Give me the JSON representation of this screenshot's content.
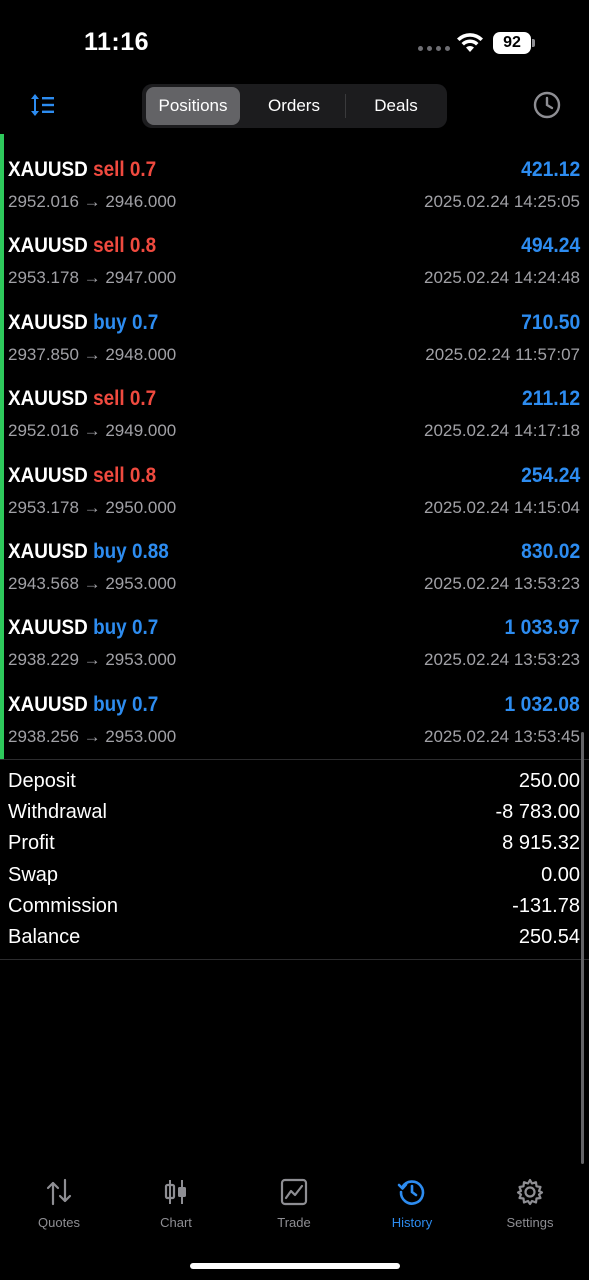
{
  "status_bar": {
    "time": "11:16",
    "battery": "92"
  },
  "toolbar": {
    "segments": [
      "Positions",
      "Orders",
      "Deals"
    ],
    "active_segment": "Positions"
  },
  "deals": [
    {
      "symbol": "XAUUSD",
      "side": "sell",
      "volume": "0.7",
      "profit": "421.12",
      "prices": "2952.016 → 2946.000",
      "datetime": "2025.02.24 14:25:05"
    },
    {
      "symbol": "XAUUSD",
      "side": "sell",
      "volume": "0.8",
      "profit": "494.24",
      "prices": "2953.178 → 2947.000",
      "datetime": "2025.02.24 14:24:48"
    },
    {
      "symbol": "XAUUSD",
      "side": "buy",
      "volume": "0.7",
      "profit": "710.50",
      "prices": "2937.850 → 2948.000",
      "datetime": "2025.02.24 11:57:07"
    },
    {
      "symbol": "XAUUSD",
      "side": "sell",
      "volume": "0.7",
      "profit": "211.12",
      "prices": "2952.016 → 2949.000",
      "datetime": "2025.02.24 14:17:18"
    },
    {
      "symbol": "XAUUSD",
      "side": "sell",
      "volume": "0.8",
      "profit": "254.24",
      "prices": "2953.178 → 2950.000",
      "datetime": "2025.02.24 14:15:04"
    },
    {
      "symbol": "XAUUSD",
      "side": "buy",
      "volume": "0.88",
      "profit": "830.02",
      "prices": "2943.568 → 2953.000",
      "datetime": "2025.02.24 13:53:23"
    },
    {
      "symbol": "XAUUSD",
      "side": "buy",
      "volume": "0.7",
      "profit": "1 033.97",
      "prices": "2938.229 → 2953.000",
      "datetime": "2025.02.24 13:53:23"
    },
    {
      "symbol": "XAUUSD",
      "side": "buy",
      "volume": "0.7",
      "profit": "1 032.08",
      "prices": "2938.256 → 2953.000",
      "datetime": "2025.02.24 13:53:45"
    }
  ],
  "summary": [
    {
      "label": "Deposit",
      "value": "250.00"
    },
    {
      "label": "Withdrawal",
      "value": "-8 783.00"
    },
    {
      "label": "Profit",
      "value": "8 915.32"
    },
    {
      "label": "Swap",
      "value": "0.00"
    },
    {
      "label": "Commission",
      "value": "-131.78"
    },
    {
      "label": "Balance",
      "value": "250.54"
    }
  ],
  "tabbar": {
    "tabs": [
      {
        "label": "Quotes",
        "icon": "quotes-arrows-icon"
      },
      {
        "label": "Chart",
        "icon": "candlestick-chart-icon"
      },
      {
        "label": "Trade",
        "icon": "trade-chart-icon"
      },
      {
        "label": "History",
        "icon": "history-clock-icon"
      },
      {
        "label": "Settings",
        "icon": "gear-icon"
      }
    ],
    "active_tab": "History"
  },
  "colors": {
    "accent": "#2d8cf0",
    "sell": "#f04a3f",
    "buy": "#2d8cf0",
    "position_bar": "#2ec95c",
    "secondary_text": "#a1a1a6"
  }
}
